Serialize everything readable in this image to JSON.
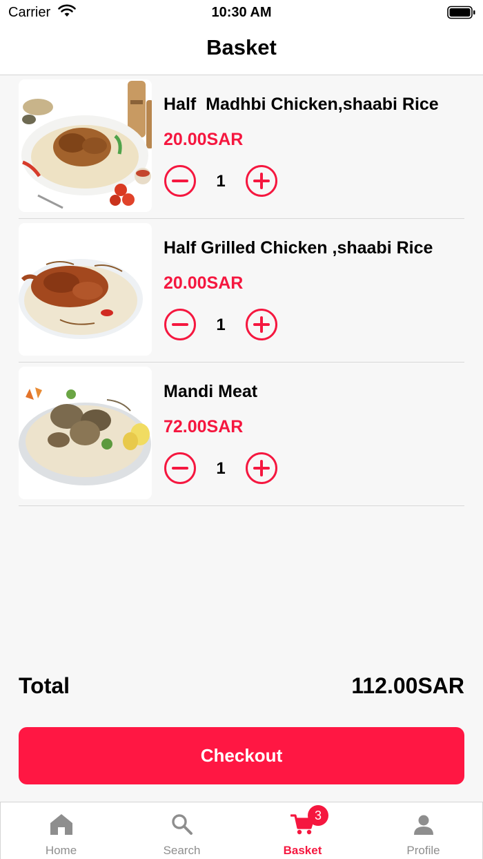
{
  "status_bar": {
    "carrier": "Carrier",
    "time": "10:30 AM"
  },
  "nav": {
    "title": "Basket"
  },
  "items": [
    {
      "name": "Half  Madhbi Chicken,shaabi Rice",
      "price": "20.00SAR",
      "quantity": "1"
    },
    {
      "name": "Half Grilled Chicken ,shaabi Rice",
      "price": "20.00SAR",
      "quantity": "1"
    },
    {
      "name": "Mandi Meat",
      "price": "72.00SAR",
      "quantity": "1"
    }
  ],
  "summary": {
    "total_label": "Total",
    "total_value": "112.00SAR"
  },
  "checkout": {
    "label": "Checkout"
  },
  "tabs": [
    {
      "label": "Home",
      "icon": "home-icon"
    },
    {
      "label": "Search",
      "icon": "search-icon"
    },
    {
      "label": "Basket",
      "icon": "cart-icon",
      "badge": "3"
    },
    {
      "label": "Profile",
      "icon": "person-icon"
    }
  ],
  "colors": {
    "accent": "#f5173f",
    "checkout": "#ff1743",
    "inactive_tab": "#8e8e8e"
  }
}
